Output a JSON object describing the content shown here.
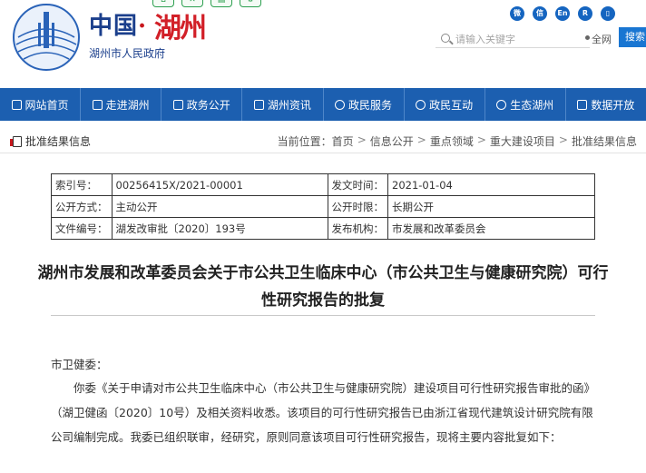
{
  "header": {
    "logo_cn": "中国",
    "logo_dot": "·",
    "logo_city": "湖州",
    "logo_sub": "湖州市人民政府",
    "tool_icons": [
      "home-icon",
      "share-icon",
      "print-icon",
      "settings-icon"
    ],
    "social_icons": [
      {
        "name": "weibo-icon",
        "glyph": "微"
      },
      {
        "name": "wechat-icon",
        "glyph": "信"
      },
      {
        "name": "english-icon",
        "glyph": "En"
      },
      {
        "name": "rss-icon",
        "glyph": "R"
      },
      {
        "name": "mobile-icon",
        "glyph": "▯"
      }
    ]
  },
  "search": {
    "placeholder": "请输入关键字",
    "scope": "全网",
    "button": "搜索"
  },
  "nav": [
    {
      "label": "网站首页",
      "icon": "home-icon"
    },
    {
      "label": "走进湖州",
      "icon": "image-icon"
    },
    {
      "label": "政务公开",
      "icon": "briefcase-icon"
    },
    {
      "label": "湖州资讯",
      "icon": "news-icon"
    },
    {
      "label": "政民服务",
      "icon": "service-icon"
    },
    {
      "label": "政民互动",
      "icon": "interaction-icon"
    },
    {
      "label": "生态湖州",
      "icon": "leaf-icon"
    },
    {
      "label": "数据开放",
      "icon": "data-icon"
    }
  ],
  "section": {
    "title": "批准结果信息"
  },
  "breadcrumb": [
    "当前位置：首页",
    "信息公开",
    "重点领域",
    "重大建设项目",
    "批准结果信息"
  ],
  "meta": {
    "index_label": "索引号：",
    "index_value": "00256415X/2021-00001",
    "date_label": "发文时间：",
    "date_value": "2021-01-04",
    "open_label": "公开方式：",
    "open_value": "主动公开",
    "period_label": "公开时限：",
    "period_value": "长期公开",
    "docno_label": "文件编号：",
    "docno_value": "湖发改审批〔2020〕193号",
    "org_label": "发布机构：",
    "org_value": "市发展和改革委员会"
  },
  "doc": {
    "title": "湖州市发展和改革委员会关于市公共卫生临床中心（市公共卫生与健康研究院）可行性研究报告的批复",
    "salutation": "市卫健委：",
    "body": "你委《关于申请对市公共卫生临床中心（市公共卫生与健康研究院）建设项目可行性研究报告审批的函》（湖卫健函〔2020〕10号）及相关资料收悉。该项目的可行性研究报告已由浙江省现代建筑设计研究院有限公司编制完成。我委已组织联审，经研究，原则同意该项目可行性研究报告，现将主要内容批复如下："
  }
}
